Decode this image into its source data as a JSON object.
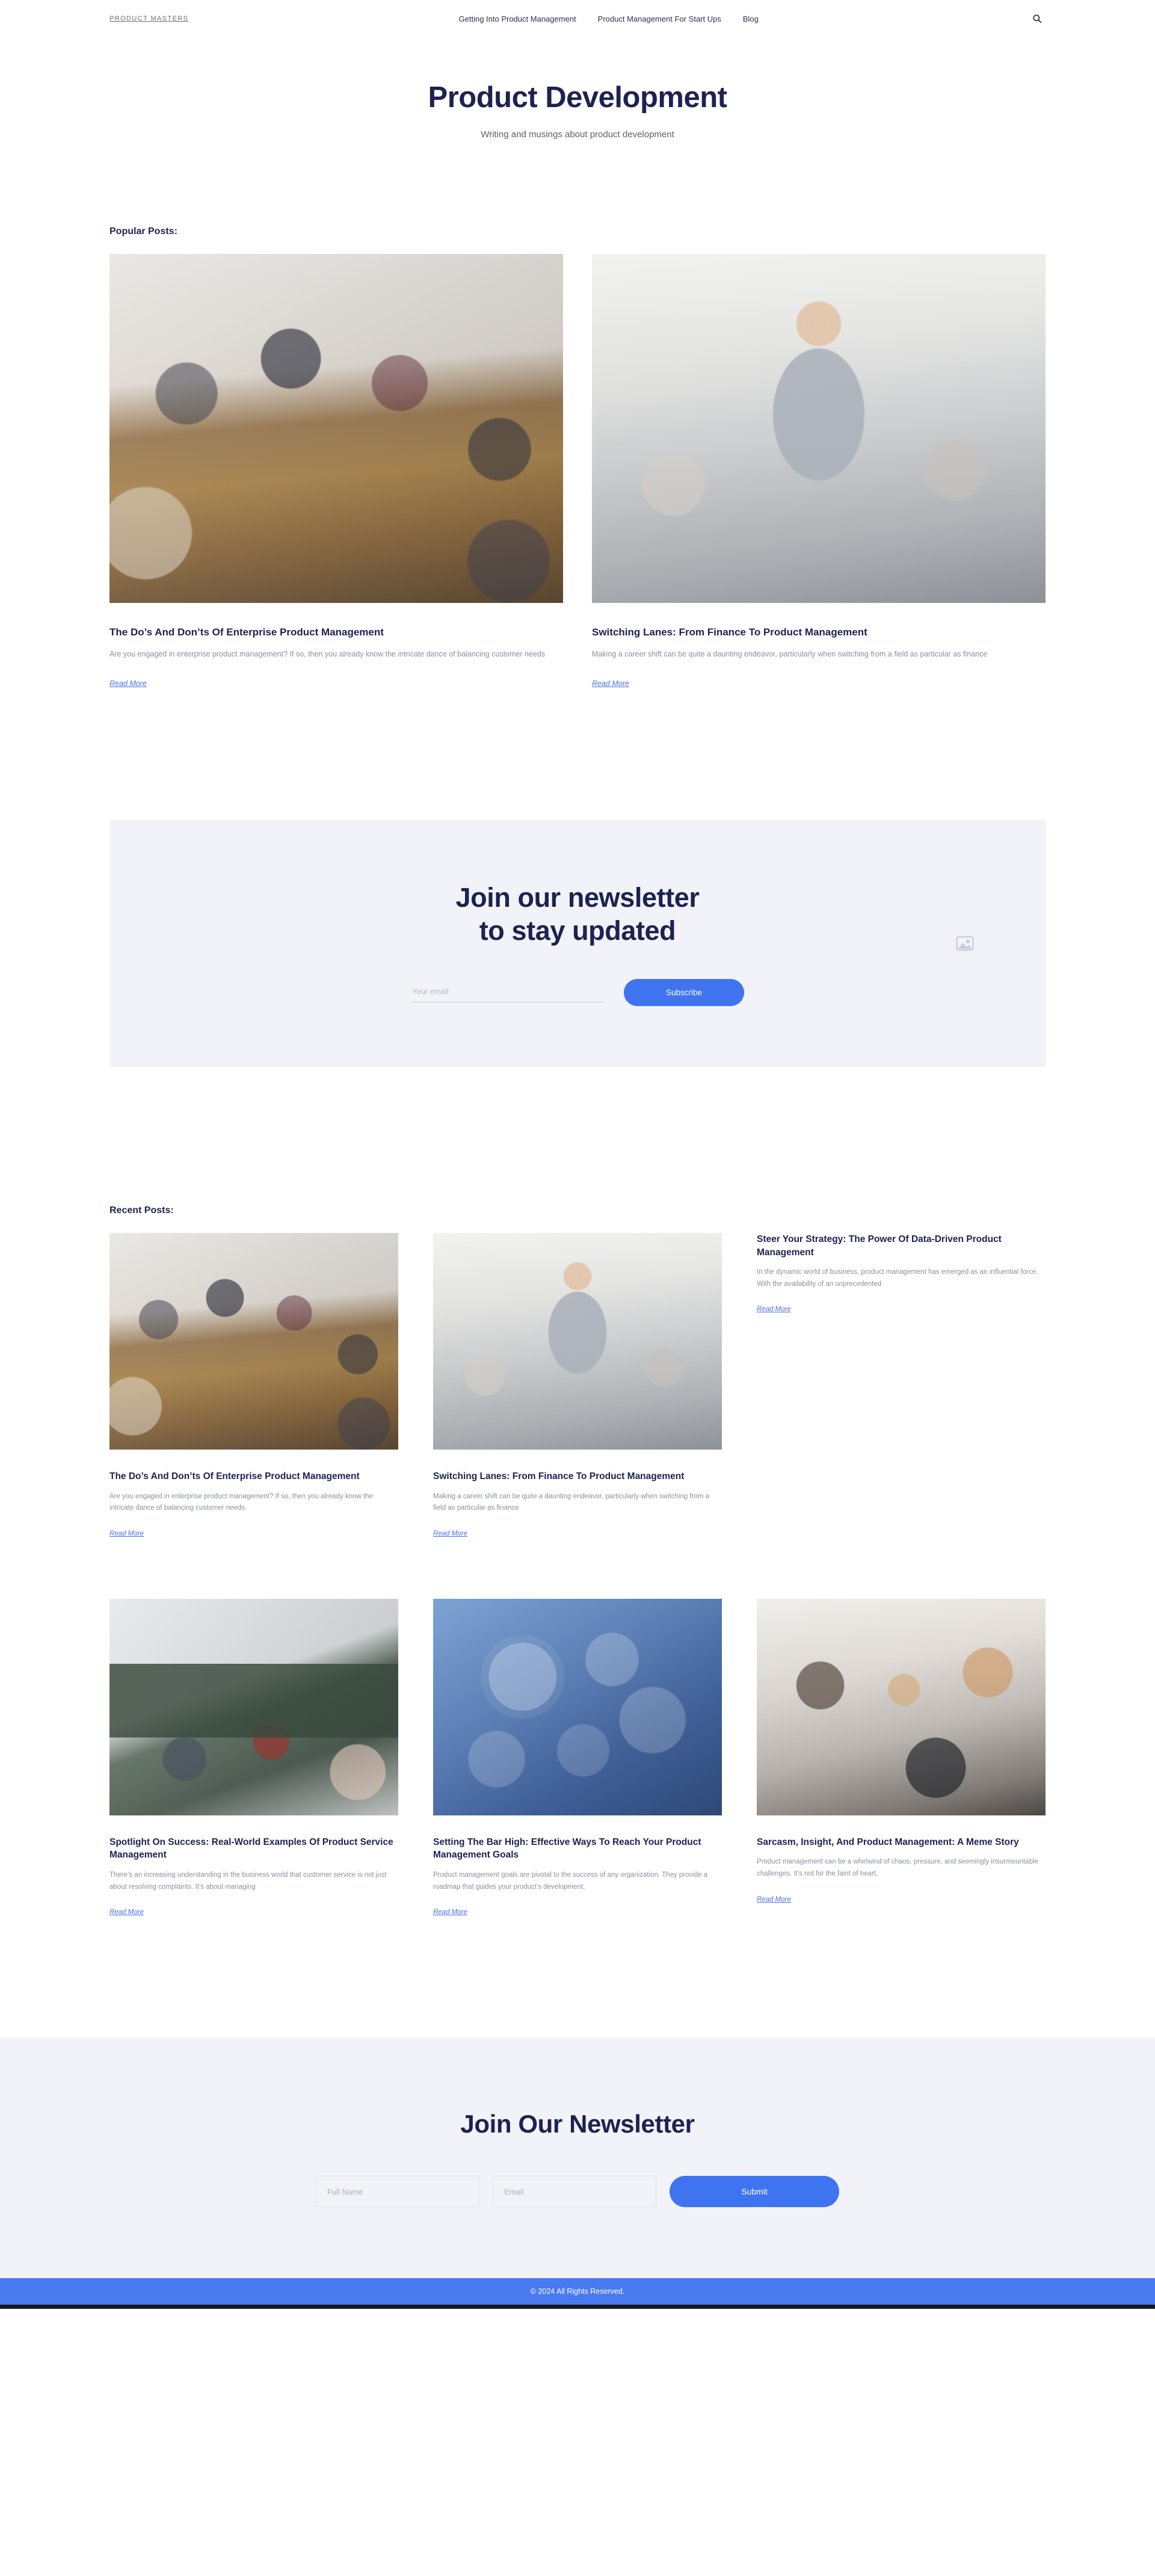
{
  "header": {
    "brand": "PRODUCT MASTERS",
    "nav": [
      {
        "label": "Getting Into Product Management"
      },
      {
        "label": "Product Management For Start Ups"
      },
      {
        "label": "Blog"
      }
    ],
    "search_icon": "search-icon"
  },
  "hero": {
    "title": "Product Development",
    "subtitle": "Writing and musings about product development"
  },
  "popular": {
    "label": "Popular Posts:",
    "posts": [
      {
        "title": "The Do’s And Don’ts Of Enterprise Product Management",
        "excerpt": "Are you engaged in enterprise product management? If so, then you already know the intricate dance of balancing customer needs",
        "read_more": "Read More",
        "image": "boardroom-meeting-photo"
      },
      {
        "title": "Switching Lanes: From Finance To Product Management",
        "excerpt": "Making a career shift can be quite a daunting endeavor, particularly when switching from a field as particular as finance",
        "read_more": "Read More",
        "image": "office-man-portrait-photo"
      }
    ]
  },
  "newsletter_banner": {
    "title_line1": "Join our newsletter",
    "title_line2": "to stay updated",
    "email_placeholder": "Your email",
    "email_value": "",
    "subscribe_label": "Subscribe",
    "side_icon": "image-placeholder-icon",
    "accent_color": "#3f74f0",
    "background_color": "#f1f3f8"
  },
  "recent": {
    "label": "Recent Posts:",
    "posts": [
      {
        "title": "The Do’s And Don’ts Of Enterprise Product Management",
        "excerpt": "Are you engaged in enterprise product management? If so, then you already know the intricate dance of balancing customer needs",
        "read_more": "Read More",
        "image": "boardroom-meeting-photo",
        "has_image": true
      },
      {
        "title": "Switching Lanes: From Finance To Product Management",
        "excerpt": "Making a career shift can be quite a daunting endeavor, particularly when switching from a field as particular as finance",
        "read_more": "Read More",
        "image": "office-man-portrait-photo",
        "has_image": true
      },
      {
        "title": "Steer Your Strategy: The Power Of Data-Driven Product Management",
        "excerpt": "In the dynamic world of business, product management has emerged as an influential force. With the availability of an unprecedented",
        "read_more": "Read More",
        "image": "",
        "has_image": false
      },
      {
        "title": "Spotlight On Success: Real-World Examples Of Product Service Management",
        "excerpt": "There’s an increasing understanding in the business world that customer service is not just about resolving complaints. It’s about managing",
        "read_more": "Read More",
        "image": "whiteboard-presentation-photo",
        "has_image": true
      },
      {
        "title": "Setting The Bar High: Effective Ways To Reach Your Product Management Goals",
        "excerpt": "Product management goals are pivotal to the success of any organization. They provide a roadmap that guides your product’s development,",
        "read_more": "Read More",
        "image": "gears-business-icons-photo",
        "has_image": true
      },
      {
        "title": "Sarcasm, Insight, And Product Management: A Meme Story",
        "excerpt": "Product management can be a whirlwind of chaos, pressure, and seemingly insurmountable challenges. It’s not for the faint of heart,",
        "read_more": "Read More",
        "image": "laughing-team-laptop-photo",
        "has_image": true
      }
    ]
  },
  "footer_newsletter": {
    "title": "Join Our Newsletter",
    "fullname_placeholder": "Full Name",
    "fullname_value": "",
    "email_placeholder": "Email",
    "email_value": "",
    "submit_label": "Submit",
    "background_color": "#f1f3f8"
  },
  "footer": {
    "copyright": "© 2024 All Rights Reserved.",
    "bar_color": "#4a7af0"
  }
}
